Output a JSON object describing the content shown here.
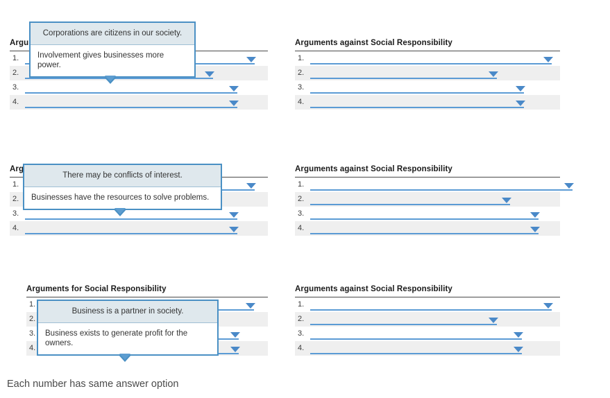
{
  "headers": {
    "for": "Arguments for Social Responsibility",
    "against": "Arguments against Social Responsibility"
  },
  "row_numbers": [
    "1.",
    "2.",
    "3.",
    "4."
  ],
  "blocks": [
    {
      "id": "block-1",
      "left_column": {
        "header": "Arguments for Social Responsibility",
        "rows": [
          {
            "number": "1.",
            "value": ""
          },
          {
            "number": "2.",
            "value": ""
          },
          {
            "number": "3.",
            "value": ""
          },
          {
            "number": "4.",
            "value": ""
          }
        ]
      },
      "right_column": {
        "header": "Arguments against Social Responsibility",
        "rows": [
          {
            "number": "1.",
            "value": ""
          },
          {
            "number": "2.",
            "value": ""
          },
          {
            "number": "3.",
            "value": ""
          },
          {
            "number": "4.",
            "value": ""
          }
        ]
      },
      "popup": {
        "highlighted_option": "Corporations are citizens in our society.",
        "option": "Involvement gives businesses more power."
      }
    },
    {
      "id": "block-2",
      "left_column": {
        "header": "Arguments for Social Responsibility",
        "rows": [
          {
            "number": "1.",
            "value": ""
          },
          {
            "number": "2.",
            "value": ""
          },
          {
            "number": "3.",
            "value": ""
          },
          {
            "number": "4.",
            "value": ""
          }
        ]
      },
      "right_column": {
        "header": "Arguments against Social Responsibility",
        "rows": [
          {
            "number": "1.",
            "value": ""
          },
          {
            "number": "2.",
            "value": ""
          },
          {
            "number": "3.",
            "value": ""
          },
          {
            "number": "4.",
            "value": ""
          }
        ]
      },
      "popup": {
        "highlighted_option": "There may be conflicts of interest.",
        "option": "Businesses have the resources to solve problems."
      }
    },
    {
      "id": "block-3",
      "left_column": {
        "header": "Arguments for Social Responsibility",
        "rows": [
          {
            "number": "1.",
            "value": ""
          },
          {
            "number": "2.",
            "value": ""
          },
          {
            "number": "3.",
            "value": ""
          },
          {
            "number": "4.",
            "value": ""
          }
        ]
      },
      "right_column": {
        "header": "Arguments against Social Responsibility",
        "rows": [
          {
            "number": "1.",
            "value": ""
          },
          {
            "number": "2.",
            "value": ""
          },
          {
            "number": "3.",
            "value": ""
          },
          {
            "number": "4.",
            "value": ""
          }
        ]
      },
      "popup": {
        "highlighted_option": "Business is a partner in society.",
        "option": "Business exists to generate profit for the owners."
      }
    }
  ],
  "footnote": "Each number has same answer option",
  "colors": {
    "accent_blue": "#5b9bd5",
    "caret_blue": "#4a89c8",
    "popup_border": "#4a90c4",
    "popup_highlight_bg": "#dfe8ed",
    "row_stripe": "#efefef",
    "rule": "#4a4a4a"
  }
}
